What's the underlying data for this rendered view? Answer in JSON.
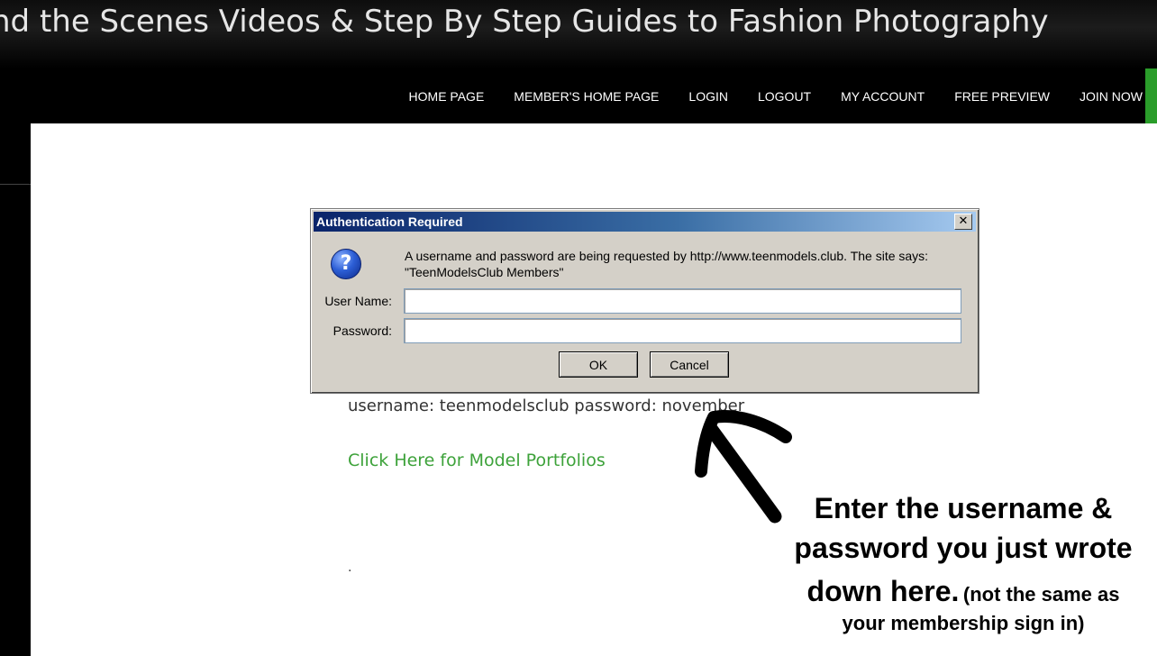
{
  "header": {
    "banner_title": "nd the Scenes Videos & Step By Step Guides to Fashion Photography"
  },
  "nav": {
    "items": [
      {
        "label": "HOME PAGE"
      },
      {
        "label": "MEMBER'S HOME PAGE"
      },
      {
        "label": "LOGIN"
      },
      {
        "label": "LOGOUT"
      },
      {
        "label": "MY ACCOUNT"
      },
      {
        "label": "FREE PREVIEW"
      },
      {
        "label": "JOIN NOW"
      }
    ],
    "accent_color": "#2a9d2a"
  },
  "dialog": {
    "title": "Authentication Required",
    "close_glyph": "✕",
    "icon": "question-icon",
    "message_line1": "A username and password are being requested by http://www.teenmodels.club. The site says:",
    "message_line2": "\"TeenModelsClub Members\"",
    "username_label": "User Name:",
    "username_value": "",
    "password_label": "Password:",
    "password_value": "",
    "ok_label": "OK",
    "cancel_label": "Cancel"
  },
  "content": {
    "credentials": "username: teenmodelsclub  password: november",
    "portfolio_link": "Click Here for Model Portfolios",
    "dot": "."
  },
  "annotation": {
    "line1": "Enter the username &",
    "line2": "password you just wrote",
    "line3": "down here.",
    "note1": "(not the same as",
    "note2": "your membership sign in)"
  }
}
